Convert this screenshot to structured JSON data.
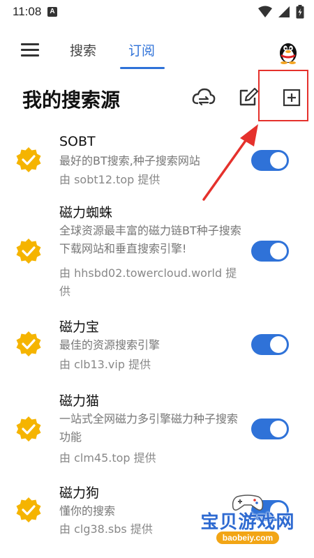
{
  "status_bar": {
    "time": "11:08",
    "notification_letter": "A"
  },
  "toolbar": {
    "tabs": [
      {
        "label": "搜索",
        "active": false
      },
      {
        "label": "订阅",
        "active": true
      }
    ],
    "accent_color": "#2f72d8"
  },
  "section": {
    "title": "我的搜索源"
  },
  "sources": [
    {
      "title": "SOBT",
      "desc": "最好的BT搜索,种子搜索网站",
      "provider": "由 sobt12.top 提供",
      "enabled": true
    },
    {
      "title": "磁力蜘蛛",
      "desc": "全球资源最丰富的磁力链BT种子搜索下载网站和垂直搜索引擎!",
      "provider": "由 hhsbd02.towercloud.world 提供",
      "enabled": true
    },
    {
      "title": "磁力宝",
      "desc": "最佳的资源搜索引擎",
      "provider": "由 clb13.vip 提供",
      "enabled": true
    },
    {
      "title": "磁力猫",
      "desc": "一站式全网磁力多引擎磁力种子搜索功能",
      "provider": "由 clm45.top 提供",
      "enabled": true
    },
    {
      "title": "磁力狗",
      "desc": "懂你的搜索",
      "provider": "由 clg38.sbs 提供",
      "enabled": true
    }
  ],
  "watermark": {
    "name": "宝贝游戏网",
    "url": "baobeiy.com"
  }
}
